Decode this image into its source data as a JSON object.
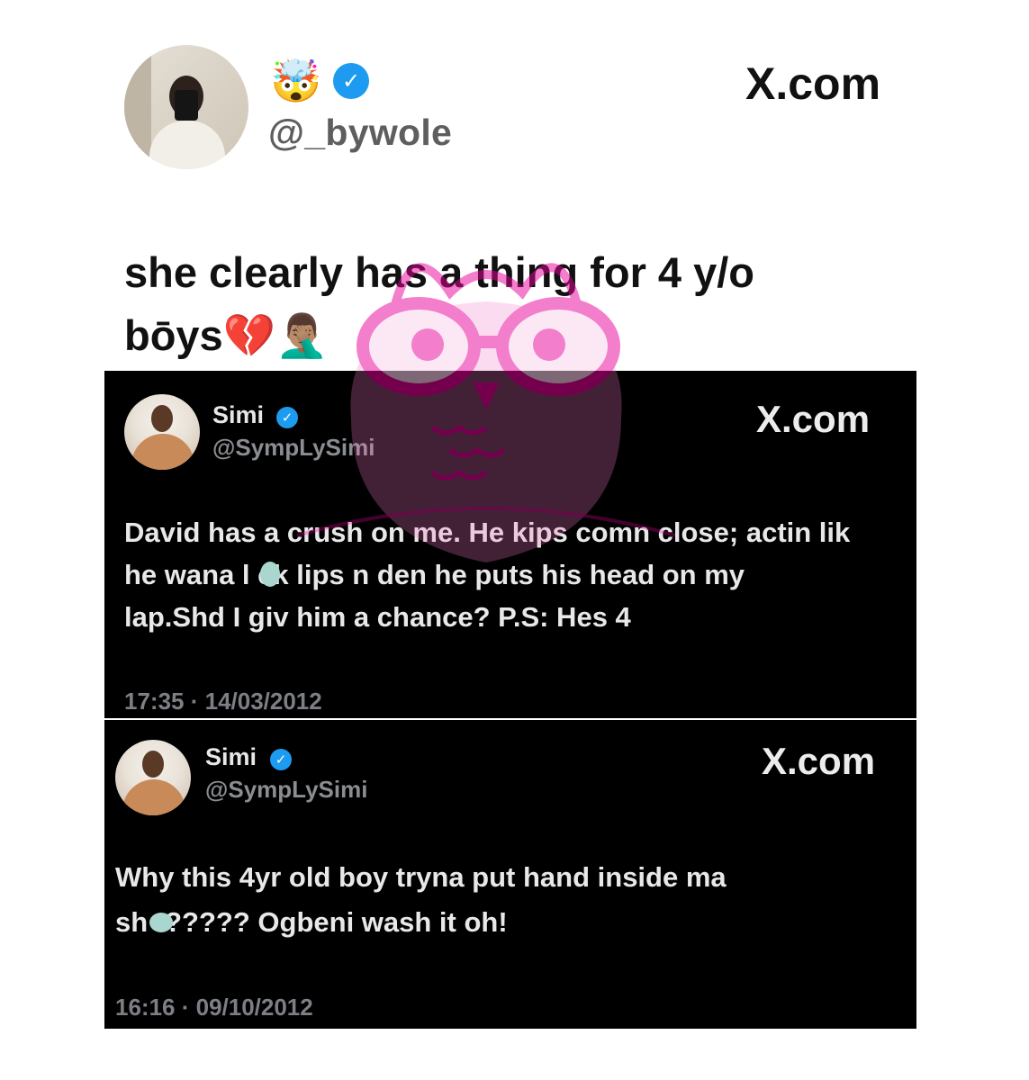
{
  "main_tweet": {
    "emoji": "🤯",
    "handle": "@_bywole",
    "site": "X.com",
    "text_line1": "she clearly has a thing for 4 y/o",
    "text_line2": "bōys💔🤦🏽‍♂️"
  },
  "colors": {
    "verified": "#1d9bf0",
    "card_background": "#000000",
    "watermark": "#e7009a"
  },
  "cards": [
    {
      "name": "Simi",
      "handle": "@SympLySimi",
      "site": "X.com",
      "lines": [
        "David has a crush on me. He kips comn close; actin lik",
        "he wana l  ck lips n den he puts his head on my",
        "lap.Shd I giv him a chance? P.S: Hes 4"
      ],
      "timestamp": "17:35 · 14/03/2012"
    },
    {
      "name": "Simi",
      "handle": "@SympLySimi",
      "site": "X.com",
      "lines": [
        "Why this 4yr old boy tryna put hand inside ma",
        "sh  t????? Ogbeni wash it oh!"
      ],
      "timestamp": "16:16 · 09/10/2012"
    }
  ],
  "icons": {
    "verified": "verified-badge-icon",
    "logo": "x-logo-icon"
  }
}
